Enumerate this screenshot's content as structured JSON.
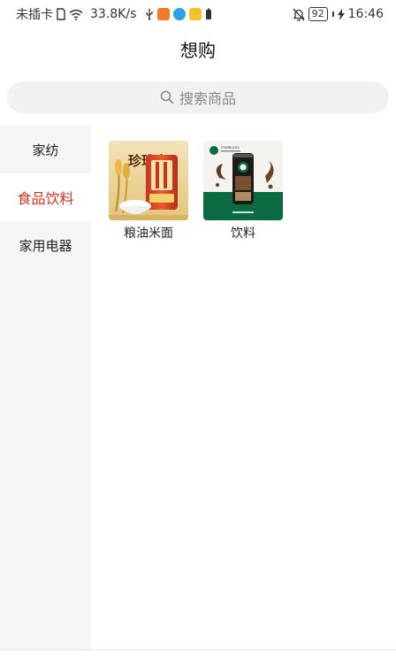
{
  "status_bar": {
    "sim": "未插卡",
    "speed": "33.8K/s",
    "battery": "92",
    "time": "16:46",
    "icons": [
      "sim-card-icon",
      "wifi-icon",
      "usb-icon",
      "app-icon-home",
      "app-icon-blue",
      "app-icon-yellow",
      "battery-small-icon",
      "bell-off-icon",
      "charging-bolt-icon"
    ]
  },
  "header": {
    "title": "想购"
  },
  "search": {
    "placeholder": "搜索商品",
    "icon": "search-icon"
  },
  "sidebar": {
    "items": [
      {
        "label": "家纺",
        "active": false
      },
      {
        "label": "食品饮料",
        "active": true
      },
      {
        "label": "家用电器",
        "active": false
      }
    ],
    "accent_color": "#d2341b"
  },
  "products": [
    {
      "label": "粮油米面",
      "image_text": "珍珠米",
      "image_kind": "rice-bag"
    },
    {
      "label": "饮料",
      "image_text": "STARBUCKS",
      "image_kind": "coffee-can"
    }
  ]
}
